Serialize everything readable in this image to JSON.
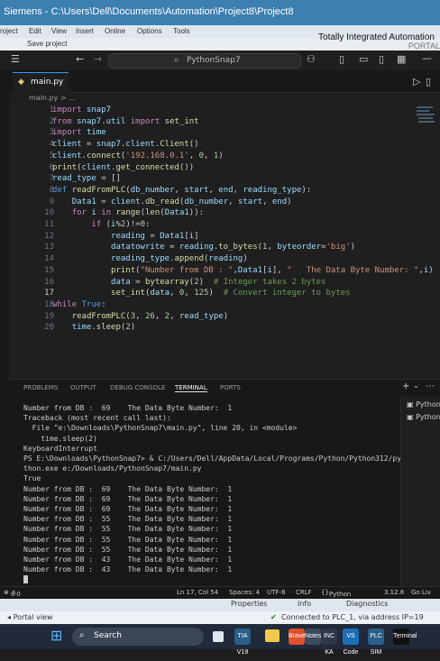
{
  "tia": {
    "window_title": "Siemens  -  C:\\Users\\Dell\\Documents\\Automation\\Project8\\Project8",
    "menu": [
      "roject",
      "Edit",
      "View",
      "Insert",
      "Online",
      "Options",
      "Tools"
    ],
    "save_label": "Save project",
    "brand": "Totally Integrated Automation",
    "brand_sub": "PORTAL",
    "bottom_tabs": [
      "Properties",
      "Info",
      "Diagnostics"
    ],
    "portal_view": "Portal view",
    "connection_status": "Connected to PLC_1, via address IP=19"
  },
  "vscode": {
    "search_label": "PythonSnap7",
    "tab_label": "main.py",
    "breadcrumb": "main.py > ...",
    "code_lines": [
      {
        "n": "1",
        "code": "import snap7"
      },
      {
        "n": "2",
        "code": "from snap7.util import set_int"
      },
      {
        "n": "3",
        "code": "import time"
      },
      {
        "n": "4",
        "code": "client = snap7.client.Client()"
      },
      {
        "n": "5",
        "code": "client.connect('192.168.0.1', 0, 1)"
      },
      {
        "n": "6",
        "code": "print(client.get_connected())"
      },
      {
        "n": "7",
        "code": "read_type = []"
      },
      {
        "n": "8",
        "code": "def readFromPLC(db_number, start, end, reading_type):"
      },
      {
        "n": "9",
        "code": "    Data1 = client.db_read(db_number, start, end)"
      },
      {
        "n": "10",
        "code": "    for i in range(len(Data1)):"
      },
      {
        "n": "11",
        "code": "        if (i%2)!=0:"
      },
      {
        "n": "12",
        "code": "            reading = Data1[i]"
      },
      {
        "n": "13",
        "code": "            datatowrite = reading.to_bytes(1, byteorder='big')"
      },
      {
        "n": "14",
        "code": "            reading_type.append(reading)"
      },
      {
        "n": "15",
        "code": "            print(\"Number from DB : \",Data1[i], \"   The Data Byte Number: \",i)"
      },
      {
        "n": "16",
        "code": "            data = bytearray(2)  # Integer takes 2 bytes"
      },
      {
        "n": "17",
        "code": "            set_int(data, 0, 125)  # Convert integer to bytes"
      },
      {
        "n": "18",
        "code": "while True:"
      },
      {
        "n": "19",
        "code": "    readFromPLC(3, 26, 2, read_type)"
      },
      {
        "n": "20",
        "code": "    time.sleep(2)"
      }
    ],
    "panel_tabs": [
      "PROBLEMS",
      "OUTPUT",
      "DEBUG CONSOLE",
      "TERMINAL",
      "PORTS"
    ],
    "terminal_lines": [
      "Number from DB :  69    The Data Byte Number:  1",
      "Traceback (most recent call last):",
      "  File \"e:\\Downloads\\PythonSnap7\\main.py\", line 20, in <module>",
      "    time.sleep(2)",
      "KeyboardInterrupt",
      "PS E:\\Downloads\\PythonSnap7> & C:/Users/Dell/AppData/Local/Programs/Python/Python312/py",
      "thon.exe e:/Downloads/PythonSnap7/main.py",
      "True",
      "Number from DB :  69    The Data Byte Number:  1",
      "Number from DB :  69    The Data Byte Number:  1",
      "Number from DB :  69    The Data Byte Number:  1",
      "Number from DB :  55    The Data Byte Number:  1",
      "Number from DB :  55    The Data Byte Number:  1",
      "Number from DB :  55    The Data Byte Number:  1",
      "Number from DB :  55    The Data Byte Number:  1",
      "Number from DB :  43    The Data Byte Number:  1",
      "Number from DB :  43    The Data Byte Number:  1"
    ],
    "terminal_sessions": [
      "Python",
      "Python"
    ],
    "status": {
      "errors": "0",
      "warnings": "0",
      "position": "Ln 17, Col 54",
      "spaces": "Spaces: 4",
      "encoding": "UTF-8",
      "eol": "CRLF",
      "language": "Python",
      "version": "3.12.8",
      "golive": "Go Liv"
    }
  },
  "taskbar": {
    "search_label": "Search",
    "icons": [
      "TIA V19",
      "Brave",
      "Notes",
      "INC KA",
      "VS Code",
      "PLC SIM",
      "Terminal"
    ]
  }
}
